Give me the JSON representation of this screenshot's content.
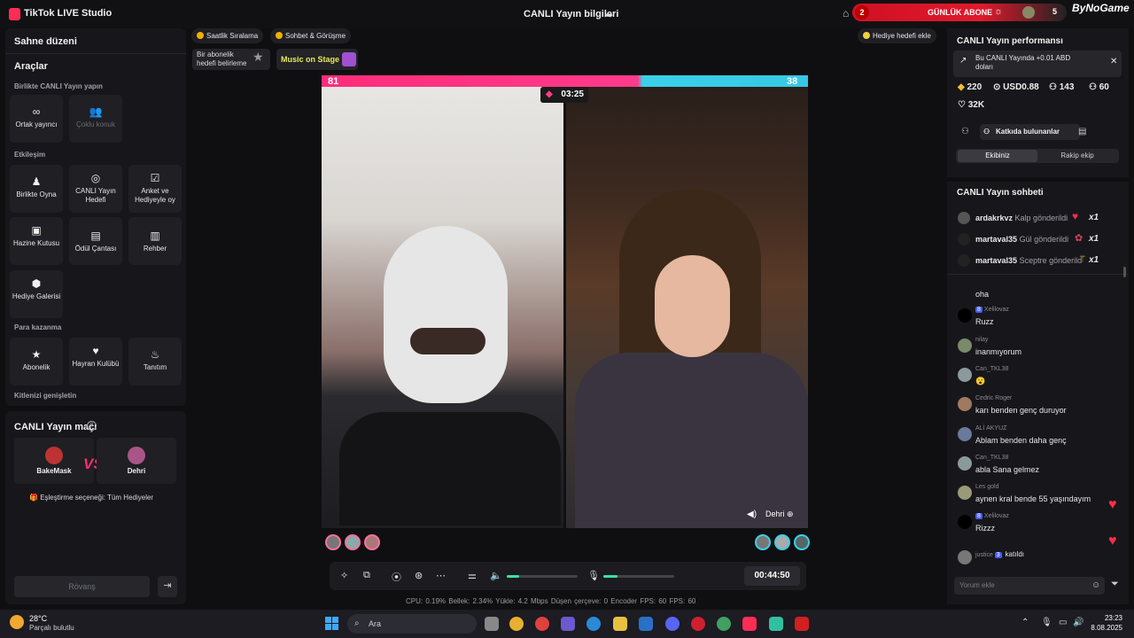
{
  "app": {
    "title": "TikTok LIVE Studio",
    "window_title": "CANLI Yayın bilgileri"
  },
  "daily_banner": {
    "rank": "2",
    "label": "GÜNLÜK ABONE",
    "count": "5",
    "brand": "ByNoGame"
  },
  "left": {
    "stage_layout": "Sahne düzeni",
    "tools_title": "Araçlar",
    "sections": {
      "together": "Birlikte CANLI Yayın yapın",
      "interaction": "Etkileşim",
      "monetize": "Para kazanma",
      "expand": "Kitlenizi genişletin"
    },
    "tools": {
      "cohost": "Ortak yayıncı",
      "multi_guest": "Çoklu konuk",
      "play_together": "Birlikte Oyna",
      "live_goal": "CANLI Yayın Hedefi",
      "poll": "Anket ve Hediyeyle oy",
      "treasure": "Hazine Kutusu",
      "reward_bag": "Ödül Çantası",
      "guide": "Rehber",
      "gift_gallery": "Hediye Galerisi",
      "subscription": "Abonelik",
      "fan_club": "Hayran Kulübü",
      "promote": "Tanıtım"
    }
  },
  "match": {
    "title": "CANLI Yayın maçı",
    "player_left": "BakeMask",
    "vs": "VS",
    "player_right": "Dehri",
    "pairing": "Eşleştirme seçeneği: Tüm Hediyeler",
    "rematch": "Rövanş"
  },
  "center": {
    "chips": {
      "hourly": "Saatlik Sıralama",
      "chat_meet": "Sohbet & Görüşme",
      "gift_goal": "Hediye hedefi ekle"
    },
    "widgets": {
      "sub_goal": "Bir abonelik hedefi belirleme",
      "stage": "Music on Stage"
    },
    "score_left": "81",
    "score_right": "38",
    "timer": "03:25",
    "opponent": "Dehri",
    "elapsed": "00:44:50",
    "stats": "CPU: 0.19%    Bellek: 2.34%    Yükle: 4.2 Mbps    Düşen çerçeve: 0    Encoder FPS: 60    FPS: 60",
    "volume_fraction": 0.18,
    "mic_fraction": 0.2
  },
  "right": {
    "perf_title": "CANLI Yayın performansı",
    "earn_text": "Bu CANLI Yayında +0.01 ABD doları",
    "stats": {
      "diamonds": "220",
      "usd": "USD0.88",
      "viewers": "143",
      "likes_small": "60",
      "likes": "32K"
    },
    "contributors": "Katkıda bulunanlar",
    "tabs": {
      "our_team": "Ekibiniz",
      "rival_team": "Rakip ekip"
    },
    "chat_title": "CANLI Yayın sohbeti",
    "gifts": [
      {
        "user": "ardakrkvz",
        "action": "Kalp gönderildi",
        "count": "x1"
      },
      {
        "user": "martaval35",
        "action": "Gül gönderildi",
        "count": "x1"
      },
      {
        "user": "martaval35",
        "action": "Sceptre gönderildi",
        "count": "x1"
      }
    ],
    "messages": [
      {
        "user": "",
        "text": "oha"
      },
      {
        "user": "Xelilovaz",
        "text": "Ruzz",
        "level": "8"
      },
      {
        "user": "nilay",
        "text": "inanmıyorum"
      },
      {
        "user": "Can_TKL38",
        "text": "😮"
      },
      {
        "user": "Cedric Roger",
        "text": "karı benden genç duruyor"
      },
      {
        "user": "ALİ AKYUZ",
        "text": "Ablam benden daha genç"
      },
      {
        "user": "Can_TKL38",
        "text": "abla Sana gelmez"
      },
      {
        "user": "Les gold",
        "text": "aynen kral bende 55 yaşındayım"
      },
      {
        "user": "Xelilovaz",
        "text": "Rizzz",
        "level": "8"
      },
      {
        "user": "justice",
        "text": "katıldı",
        "level": "3"
      }
    ],
    "comment_placeholder": "Yorum ekle"
  },
  "taskbar": {
    "temp": "28°C",
    "weather": "Parçalı bulutlu",
    "search": "Ara",
    "time": "23:23",
    "date": "8.08.2025"
  }
}
